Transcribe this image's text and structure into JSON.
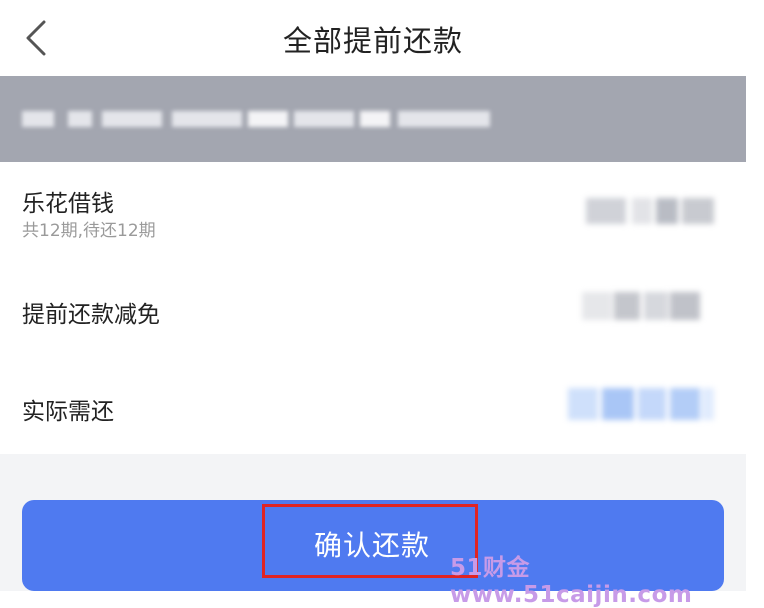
{
  "header": {
    "back_icon": "chevron-left-icon",
    "title": "全部提前还款"
  },
  "colors": {
    "accent": "#4f7af0",
    "highlight": "#e02424",
    "banner": "#a3a6b0"
  },
  "rows": [
    {
      "label": "乐花借钱",
      "sub": "共12期,待还12期"
    },
    {
      "label": "提前还款减免"
    },
    {
      "label": "实际需还"
    }
  ],
  "actions": {
    "confirm_label": "确认还款"
  },
  "watermark": "51财金www.51caijin.com"
}
